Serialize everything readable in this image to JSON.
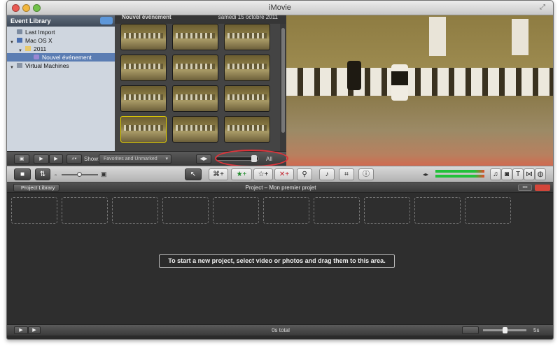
{
  "window": {
    "title": "iMovie"
  },
  "sidebar": {
    "header": "Event Library",
    "items": [
      {
        "label": "Last Import"
      },
      {
        "label": "Mac OS X"
      },
      {
        "label": "2011"
      },
      {
        "label": "Nouvel événement"
      },
      {
        "label": "Virtual Machines"
      }
    ]
  },
  "browser": {
    "event_name": "Nouvel événement",
    "event_date": "samedi 15 octobre 2011",
    "thumbnail_count": 12
  },
  "browser_toolbar": {
    "show_label": "Show:",
    "filter_value": "Favorites and Unmarked",
    "zoom_value_label": "All"
  },
  "project": {
    "library_button": "Project Library",
    "title": "Project – Mon premier projet",
    "hint": "To start a new project, select video or photos and drag them to this area.",
    "total": "0s total",
    "zoom_label": "5s"
  },
  "icons": {
    "mark_favorite": "star-plus-icon",
    "unmark": "star-outline-icon",
    "reject": "x-plus-icon",
    "keyword": "key-icon",
    "voiceover": "microphone-icon",
    "crop": "crop-icon",
    "inspector": "info-icon"
  },
  "colors": {
    "annotation_ring": "#e0333a",
    "selected_row": "#5b7db3",
    "audio_meter": "#22c03a"
  }
}
